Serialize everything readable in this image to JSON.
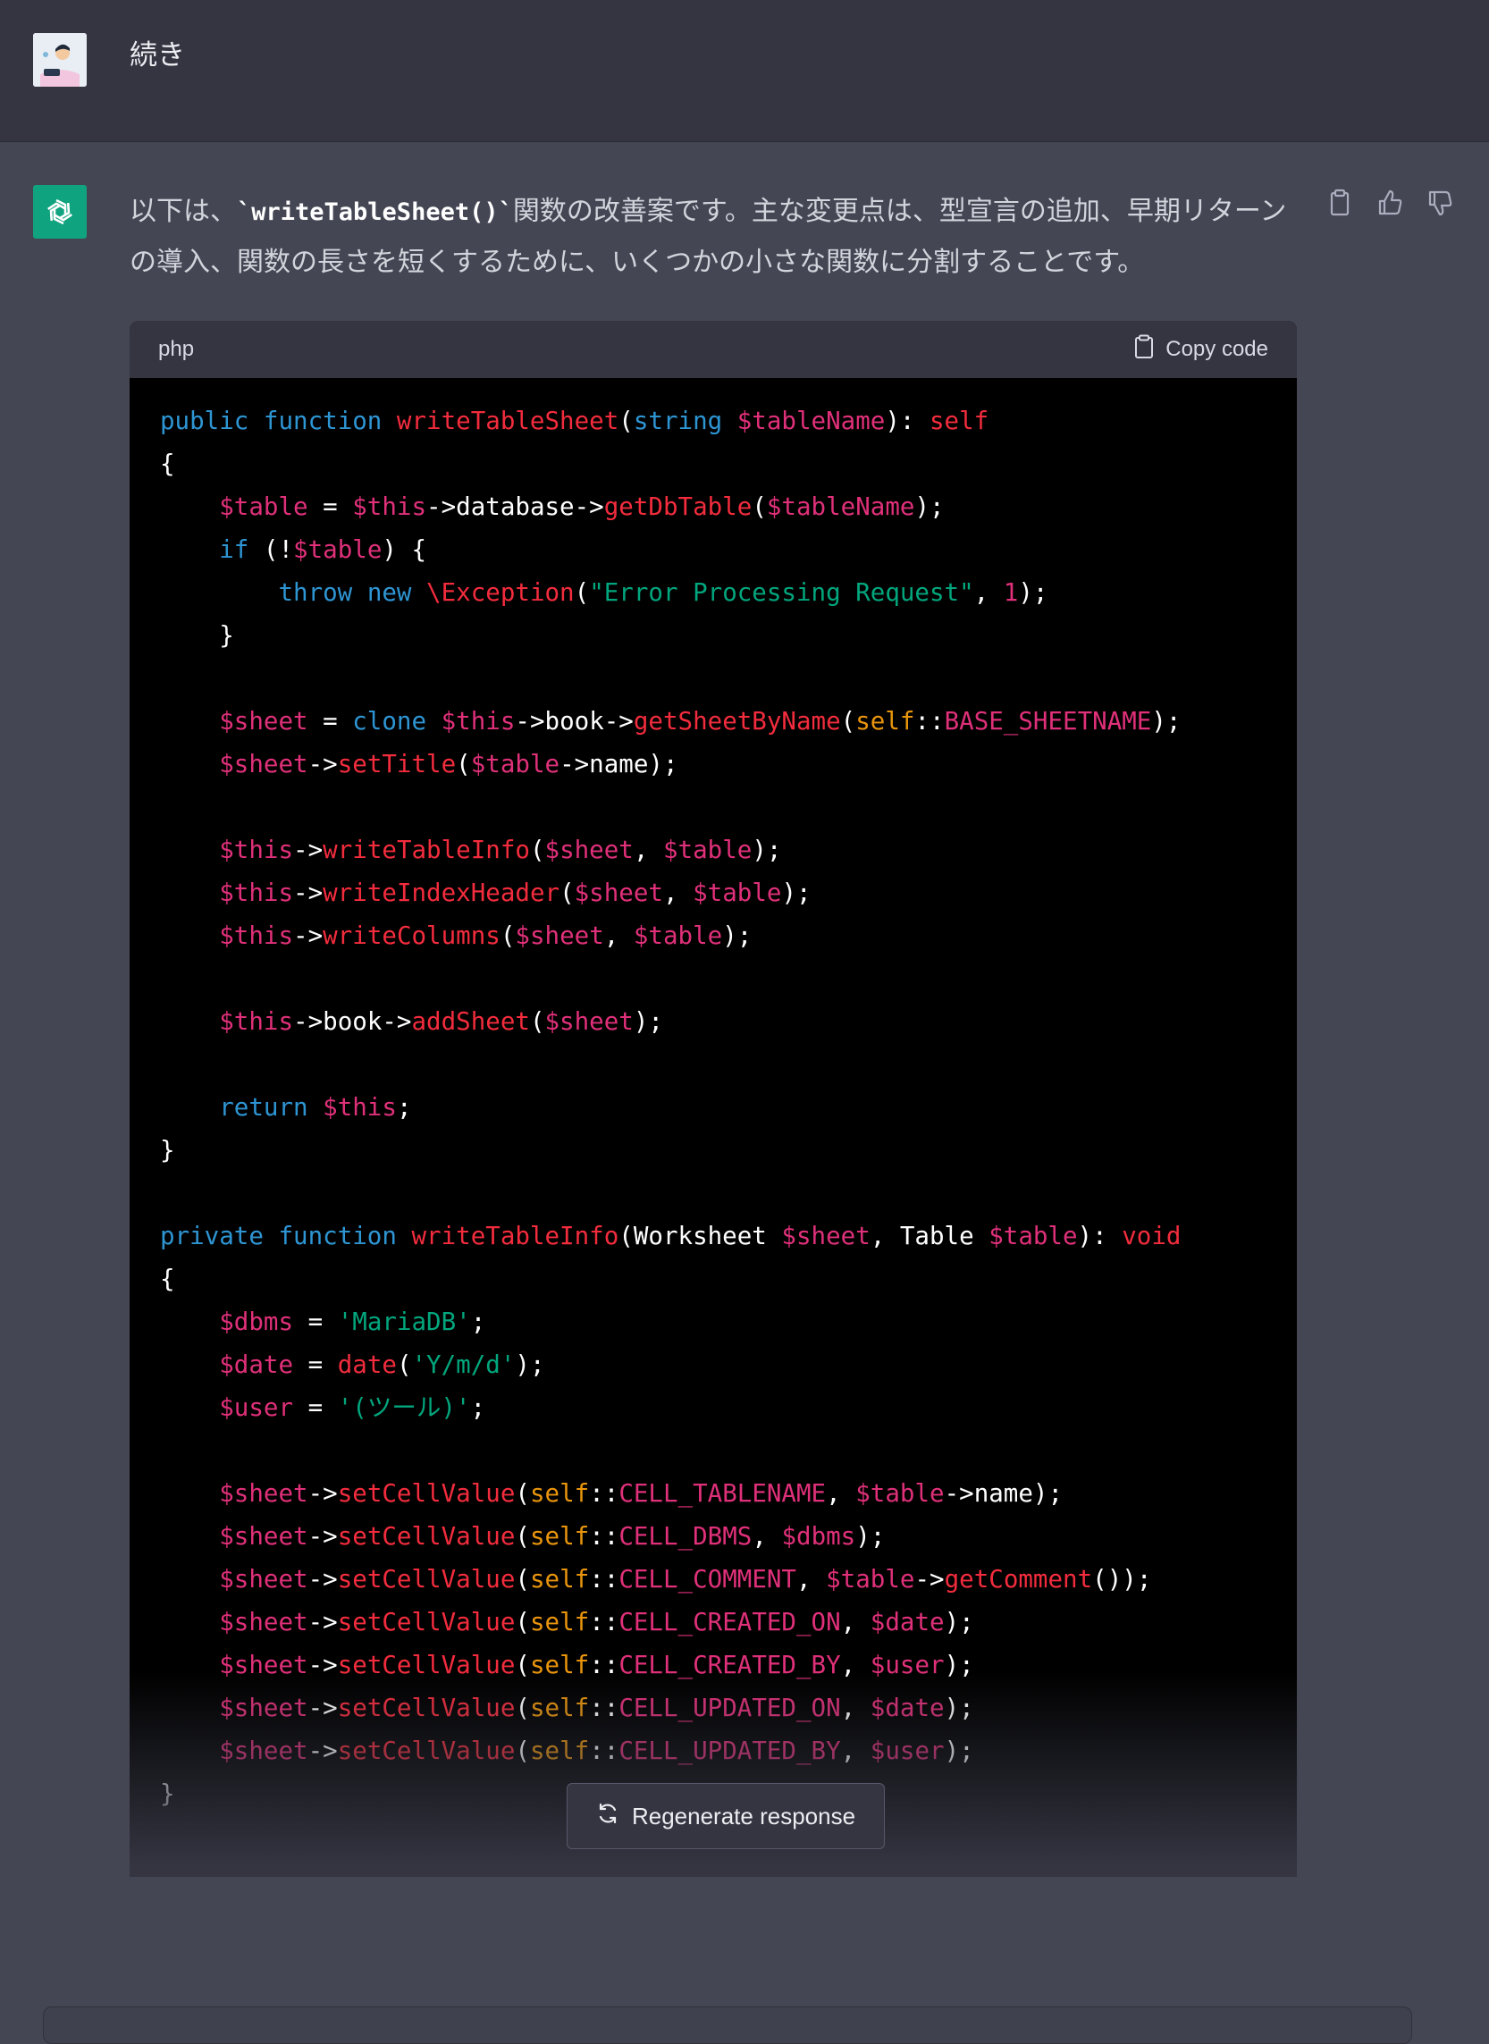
{
  "user_message": {
    "text": "続き",
    "avatar_icon": "user-avatar-icon"
  },
  "assistant_message": {
    "avatar_icon": "openai-logo-icon",
    "intro_before": "以下は、",
    "intro_code": "`writeTableSheet()`",
    "intro_after": "関数の改善案です。主な変更点は、型宣言の追加、早期リターンの導入、関数の長さを短くするために、いくつかの小さな関数に分割することです。",
    "actions": [
      "clipboard-icon",
      "thumbs-up-icon",
      "thumbs-down-icon"
    ]
  },
  "code_block": {
    "language": "php",
    "copy_label": "Copy code",
    "lines": [
      [
        [
          "kw",
          "public"
        ],
        [
          "pn",
          " "
        ],
        [
          "kw",
          "function"
        ],
        [
          "pn",
          " "
        ],
        [
          "fn",
          "writeTableSheet"
        ],
        [
          "pn",
          "("
        ],
        [
          "kw",
          "string"
        ],
        [
          "pn",
          " "
        ],
        [
          "var",
          "$tableName"
        ],
        [
          "pn",
          "): "
        ],
        [
          "fn",
          "self"
        ]
      ],
      [
        [
          "pn",
          "{"
        ]
      ],
      [
        [
          "pn",
          "    "
        ],
        [
          "var",
          "$table"
        ],
        [
          "pn",
          " = "
        ],
        [
          "var",
          "$this"
        ],
        [
          "pn",
          "->database->"
        ],
        [
          "fn",
          "getDbTable"
        ],
        [
          "pn",
          "("
        ],
        [
          "var",
          "$tableName"
        ],
        [
          "pn",
          ");"
        ]
      ],
      [
        [
          "pn",
          "    "
        ],
        [
          "kw",
          "if"
        ],
        [
          "pn",
          " (!"
        ],
        [
          "var",
          "$table"
        ],
        [
          "pn",
          ") {"
        ]
      ],
      [
        [
          "pn",
          "        "
        ],
        [
          "kw",
          "throw"
        ],
        [
          "pn",
          " "
        ],
        [
          "kw",
          "new"
        ],
        [
          "pn",
          " "
        ],
        [
          "fn",
          "\\Exception"
        ],
        [
          "pn",
          "("
        ],
        [
          "str",
          "\"Error Processing Request\""
        ],
        [
          "pn",
          ", "
        ],
        [
          "num",
          "1"
        ],
        [
          "pn",
          ");"
        ]
      ],
      [
        [
          "pn",
          "    }"
        ]
      ],
      [
        [
          "pn",
          ""
        ]
      ],
      [
        [
          "pn",
          "    "
        ],
        [
          "var",
          "$sheet"
        ],
        [
          "pn",
          " = "
        ],
        [
          "kw",
          "clone"
        ],
        [
          "pn",
          " "
        ],
        [
          "var",
          "$this"
        ],
        [
          "pn",
          "->book->"
        ],
        [
          "fn",
          "getSheetByName"
        ],
        [
          "pn",
          "("
        ],
        [
          "slf",
          "self"
        ],
        [
          "pn",
          "::"
        ],
        [
          "cst",
          "BASE_SHEETNAME"
        ],
        [
          "pn",
          ");"
        ]
      ],
      [
        [
          "pn",
          "    "
        ],
        [
          "var",
          "$sheet"
        ],
        [
          "pn",
          "->"
        ],
        [
          "fn",
          "setTitle"
        ],
        [
          "pn",
          "("
        ],
        [
          "var",
          "$table"
        ],
        [
          "pn",
          "->name);"
        ]
      ],
      [
        [
          "pn",
          ""
        ]
      ],
      [
        [
          "pn",
          "    "
        ],
        [
          "var",
          "$this"
        ],
        [
          "pn",
          "->"
        ],
        [
          "fn",
          "writeTableInfo"
        ],
        [
          "pn",
          "("
        ],
        [
          "var",
          "$sheet"
        ],
        [
          "pn",
          ", "
        ],
        [
          "var",
          "$table"
        ],
        [
          "pn",
          ");"
        ]
      ],
      [
        [
          "pn",
          "    "
        ],
        [
          "var",
          "$this"
        ],
        [
          "pn",
          "->"
        ],
        [
          "fn",
          "writeIndexHeader"
        ],
        [
          "pn",
          "("
        ],
        [
          "var",
          "$sheet"
        ],
        [
          "pn",
          ", "
        ],
        [
          "var",
          "$table"
        ],
        [
          "pn",
          ");"
        ]
      ],
      [
        [
          "pn",
          "    "
        ],
        [
          "var",
          "$this"
        ],
        [
          "pn",
          "->"
        ],
        [
          "fn",
          "writeColumns"
        ],
        [
          "pn",
          "("
        ],
        [
          "var",
          "$sheet"
        ],
        [
          "pn",
          ", "
        ],
        [
          "var",
          "$table"
        ],
        [
          "pn",
          ");"
        ]
      ],
      [
        [
          "pn",
          ""
        ]
      ],
      [
        [
          "pn",
          "    "
        ],
        [
          "var",
          "$this"
        ],
        [
          "pn",
          "->book->"
        ],
        [
          "fn",
          "addSheet"
        ],
        [
          "pn",
          "("
        ],
        [
          "var",
          "$sheet"
        ],
        [
          "pn",
          ");"
        ]
      ],
      [
        [
          "pn",
          ""
        ]
      ],
      [
        [
          "pn",
          "    "
        ],
        [
          "kw",
          "return"
        ],
        [
          "pn",
          " "
        ],
        [
          "var",
          "$this"
        ],
        [
          "pn",
          ";"
        ]
      ],
      [
        [
          "pn",
          "}"
        ]
      ],
      [
        [
          "pn",
          ""
        ]
      ],
      [
        [
          "kw",
          "private"
        ],
        [
          "pn",
          " "
        ],
        [
          "kw",
          "function"
        ],
        [
          "pn",
          " "
        ],
        [
          "fn",
          "writeTableInfo"
        ],
        [
          "pn",
          "(Worksheet "
        ],
        [
          "var",
          "$sheet"
        ],
        [
          "pn",
          ", Table "
        ],
        [
          "var",
          "$table"
        ],
        [
          "pn",
          "): "
        ],
        [
          "fn",
          "void"
        ]
      ],
      [
        [
          "pn",
          "{"
        ]
      ],
      [
        [
          "pn",
          "    "
        ],
        [
          "var",
          "$dbms"
        ],
        [
          "pn",
          " = "
        ],
        [
          "str",
          "'MariaDB'"
        ],
        [
          "pn",
          ";"
        ]
      ],
      [
        [
          "pn",
          "    "
        ],
        [
          "var",
          "$date"
        ],
        [
          "pn",
          " = "
        ],
        [
          "fn",
          "date"
        ],
        [
          "pn",
          "("
        ],
        [
          "str",
          "'Y/m/d'"
        ],
        [
          "pn",
          ");"
        ]
      ],
      [
        [
          "pn",
          "    "
        ],
        [
          "var",
          "$user"
        ],
        [
          "pn",
          " = "
        ],
        [
          "str",
          "'(ツール)'"
        ],
        [
          "pn",
          ";"
        ]
      ],
      [
        [
          "pn",
          ""
        ]
      ],
      [
        [
          "pn",
          "    "
        ],
        [
          "var",
          "$sheet"
        ],
        [
          "pn",
          "->"
        ],
        [
          "fn",
          "setCellValue"
        ],
        [
          "pn",
          "("
        ],
        [
          "slf",
          "self"
        ],
        [
          "pn",
          "::"
        ],
        [
          "cst",
          "CELL_TABLENAME"
        ],
        [
          "pn",
          ", "
        ],
        [
          "var",
          "$table"
        ],
        [
          "pn",
          "->name);"
        ]
      ],
      [
        [
          "pn",
          "    "
        ],
        [
          "var",
          "$sheet"
        ],
        [
          "pn",
          "->"
        ],
        [
          "fn",
          "setCellValue"
        ],
        [
          "pn",
          "("
        ],
        [
          "slf",
          "self"
        ],
        [
          "pn",
          "::"
        ],
        [
          "cst",
          "CELL_DBMS"
        ],
        [
          "pn",
          ", "
        ],
        [
          "var",
          "$dbms"
        ],
        [
          "pn",
          ");"
        ]
      ],
      [
        [
          "pn",
          "    "
        ],
        [
          "var",
          "$sheet"
        ],
        [
          "pn",
          "->"
        ],
        [
          "fn",
          "setCellValue"
        ],
        [
          "pn",
          "("
        ],
        [
          "slf",
          "self"
        ],
        [
          "pn",
          "::"
        ],
        [
          "cst",
          "CELL_COMMENT"
        ],
        [
          "pn",
          ", "
        ],
        [
          "var",
          "$table"
        ],
        [
          "pn",
          "->"
        ],
        [
          "fn",
          "getComment"
        ],
        [
          "pn",
          "());"
        ]
      ],
      [
        [
          "pn",
          "    "
        ],
        [
          "var",
          "$sheet"
        ],
        [
          "pn",
          "->"
        ],
        [
          "fn",
          "setCellValue"
        ],
        [
          "pn",
          "("
        ],
        [
          "slf",
          "self"
        ],
        [
          "pn",
          "::"
        ],
        [
          "cst",
          "CELL_CREATED_ON"
        ],
        [
          "pn",
          ", "
        ],
        [
          "var",
          "$date"
        ],
        [
          "pn",
          ");"
        ]
      ],
      [
        [
          "pn",
          "    "
        ],
        [
          "var",
          "$sheet"
        ],
        [
          "pn",
          "->"
        ],
        [
          "fn",
          "setCellValue"
        ],
        [
          "pn",
          "("
        ],
        [
          "slf",
          "self"
        ],
        [
          "pn",
          "::"
        ],
        [
          "cst",
          "CELL_CREATED_BY"
        ],
        [
          "pn",
          ", "
        ],
        [
          "var",
          "$user"
        ],
        [
          "pn",
          ");"
        ]
      ],
      [
        [
          "pn",
          "    "
        ],
        [
          "var",
          "$sheet"
        ],
        [
          "pn",
          "->"
        ],
        [
          "fn",
          "setCellValue"
        ],
        [
          "pn",
          "("
        ],
        [
          "slf",
          "self"
        ],
        [
          "pn",
          "::"
        ],
        [
          "cst",
          "CELL_UPDATED_ON"
        ],
        [
          "pn",
          ", "
        ],
        [
          "var",
          "$date"
        ],
        [
          "pn",
          ");"
        ]
      ],
      [
        [
          "pn",
          "    "
        ],
        [
          "var",
          "$sheet"
        ],
        [
          "pn",
          "->"
        ],
        [
          "fn",
          "setCellValue"
        ],
        [
          "pn",
          "("
        ],
        [
          "slf",
          "self"
        ],
        [
          "pn",
          "::"
        ],
        [
          "cst",
          "CELL_UPDATED_BY"
        ],
        [
          "pn",
          ", "
        ],
        [
          "var",
          "$user"
        ],
        [
          "pn",
          ");"
        ]
      ],
      [
        [
          "pn",
          "}"
        ]
      ]
    ]
  },
  "regenerate_button": {
    "label": "Regenerate response",
    "icon": "refresh-icon"
  },
  "colors": {
    "page_bg": "#444654",
    "user_row_bg": "#343541",
    "code_bg": "#000000",
    "brand_green": "#10a37f",
    "keyword": "#2e95d3",
    "function": "#f22c3d",
    "variable": "#df3079",
    "string": "#00a67d",
    "self": "#e9950c"
  }
}
